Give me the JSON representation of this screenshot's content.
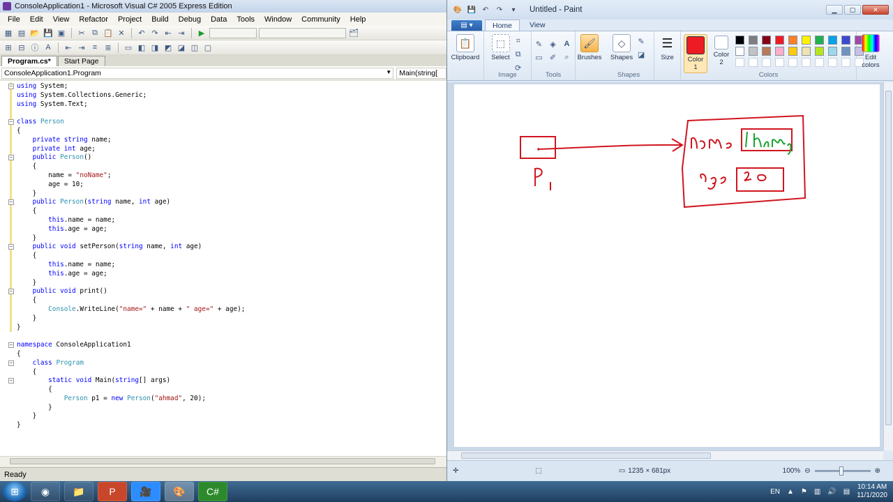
{
  "vs": {
    "title": "ConsoleApplication1 - Microsoft Visual C# 2005 Express Edition",
    "menu": [
      "File",
      "Edit",
      "View",
      "Refactor",
      "Project",
      "Build",
      "Debug",
      "Data",
      "Tools",
      "Window",
      "Community",
      "Help"
    ],
    "tabs": [
      "Program.cs*",
      "Start Page"
    ],
    "nav_left": "ConsoleApplication1.Program",
    "nav_right": "Main(string[",
    "status": "Ready",
    "code_lines": [
      "using System;",
      "using System.Collections.Generic;",
      "using System.Text;",
      "",
      "class Person",
      "{",
      "    private string name;",
      "    private int age;",
      "    public Person()",
      "    {",
      "        name = \"noName\";",
      "        age = 10;",
      "    }",
      "    public Person(string name, int age)",
      "    {",
      "        this.name = name;",
      "        this.age = age;",
      "    }",
      "    public void setPerson(string name, int age)",
      "    {",
      "        this.name = name;",
      "        this.age = age;",
      "    }",
      "    public void print()",
      "    {",
      "        Console.WriteLine(\"name=\" + name + \" age=\" + age);",
      "    }",
      "}",
      "",
      "namespace ConsoleApplication1",
      "{",
      "    class Program",
      "    {",
      "        static void Main(string[] args)",
      "        {",
      "            Person p1 = new Person(\"ahmad\", 20);",
      "        }",
      "    }",
      "}"
    ]
  },
  "paint": {
    "title": "Untitled - Paint",
    "tabs": [
      "Home",
      "View"
    ],
    "groups": {
      "clipboard": "Clipboard",
      "select": "Select",
      "image": "Image",
      "tools": "Tools",
      "brushes": "Brushes",
      "shapes_btn": "Shapes",
      "shapes": "Shapes",
      "size": "Size",
      "color1": "Color 1",
      "color2": "Color 2",
      "colors": "Colors",
      "edit_colors": "Edit colors"
    },
    "palette": [
      "#000000",
      "#7f7f7f",
      "#880015",
      "#ed1c24",
      "#ff7f27",
      "#fff200",
      "#22b14c",
      "#00a2e8",
      "#3f48cc",
      "#a349a4",
      "#ffffff",
      "#c3c3c3",
      "#b97a57",
      "#ffaec9",
      "#ffc90e",
      "#efe4b0",
      "#b5e61d",
      "#99d9ea",
      "#7092be",
      "#c8bfe7"
    ],
    "color1": "#ed1c24",
    "color2": "#ffffff",
    "canvas_size": "1235 × 681px",
    "zoom": "100%"
  },
  "taskbar": {
    "lang": "EN",
    "time": "10:14 AM",
    "date": "11/1/2020"
  }
}
